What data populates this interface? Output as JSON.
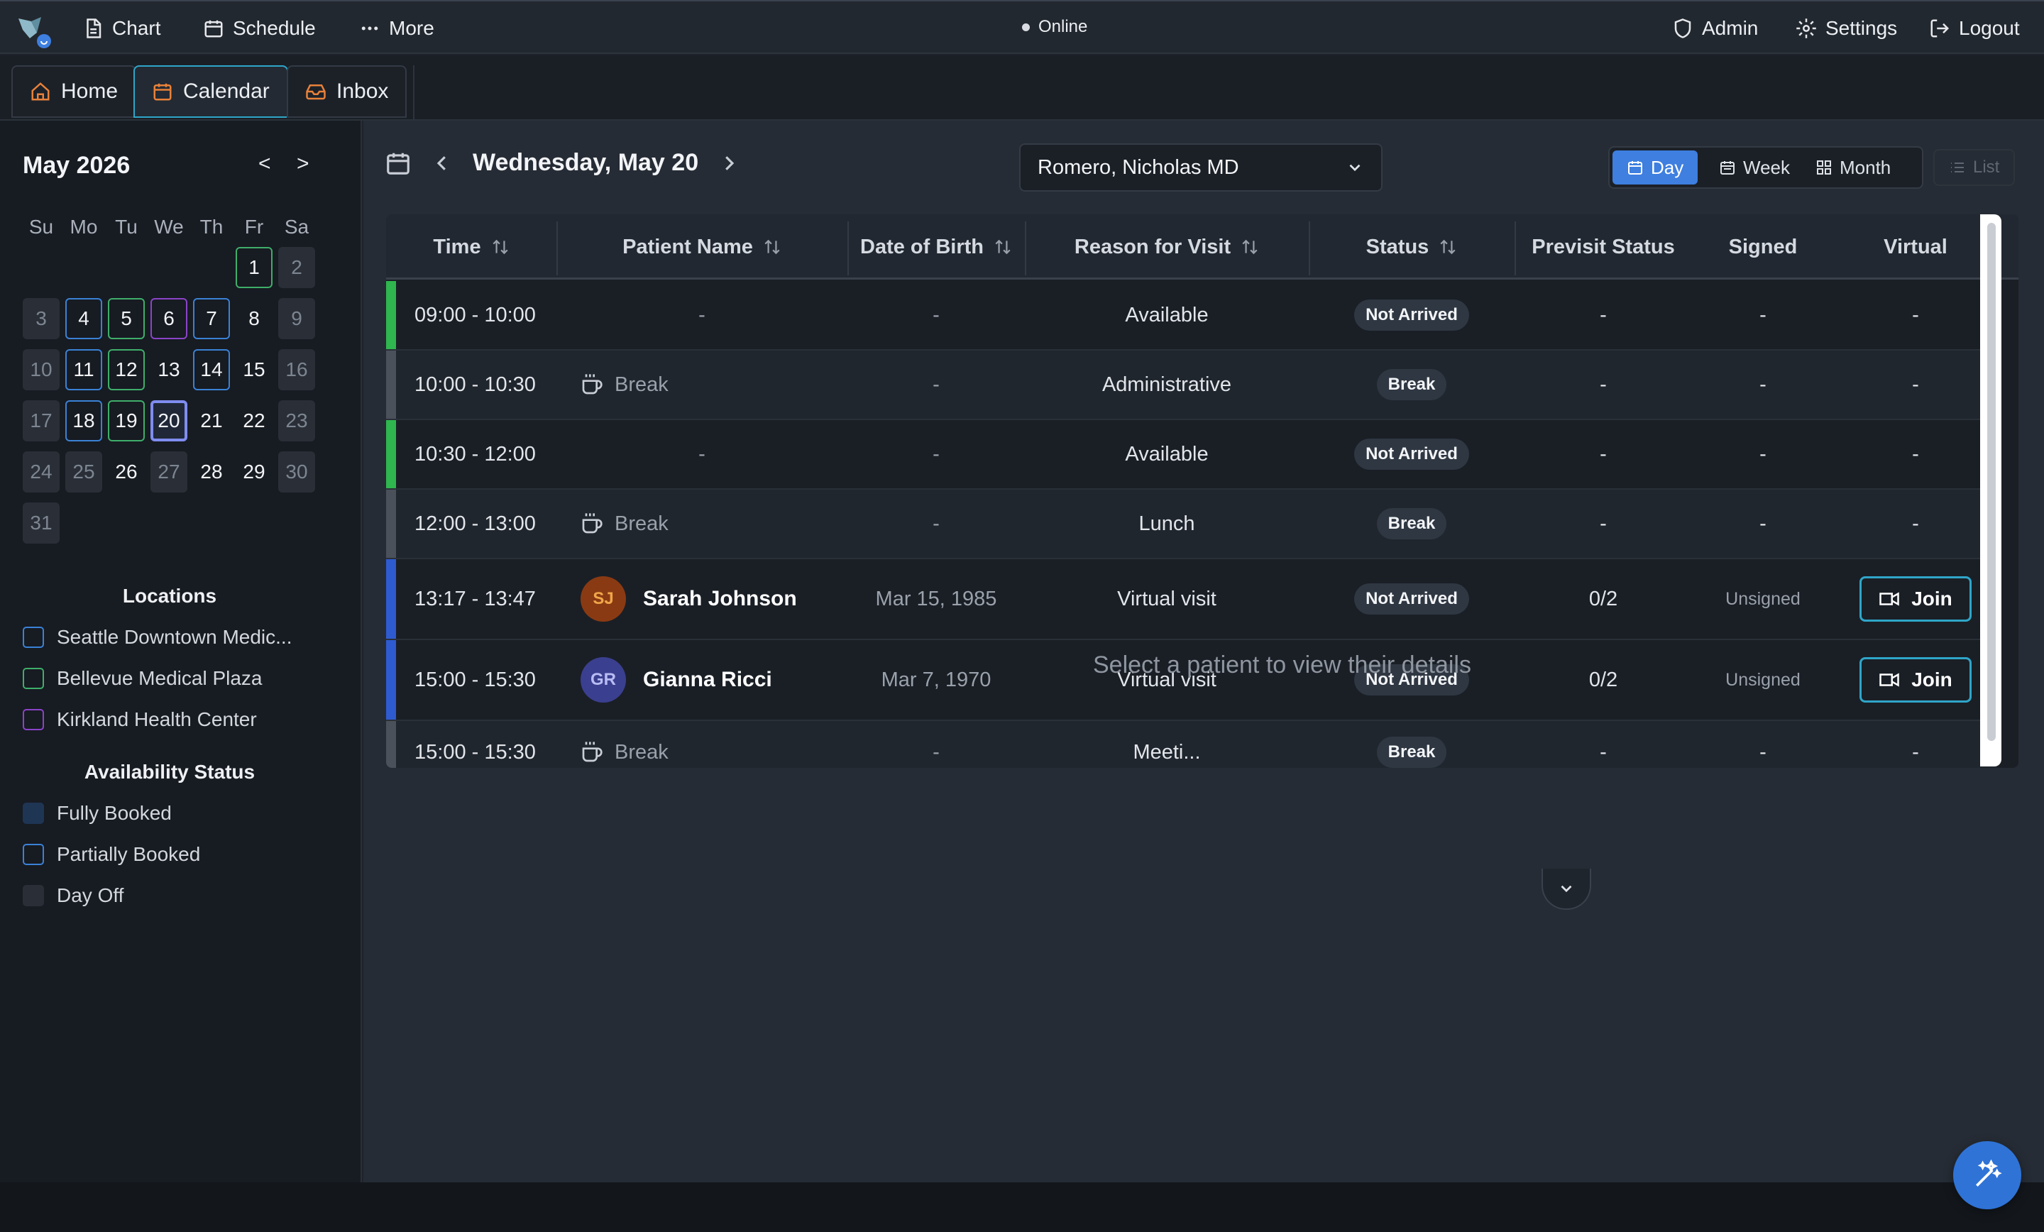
{
  "topbar": {
    "nav": [
      {
        "label": "Chart",
        "icon": "document-icon"
      },
      {
        "label": "Schedule",
        "icon": "calendar-icon"
      },
      {
        "label": "More",
        "icon": "more-dots-icon"
      }
    ],
    "status": "Online",
    "right": [
      {
        "label": "Admin",
        "icon": "shield-icon"
      },
      {
        "label": "Settings",
        "icon": "gear-icon"
      },
      {
        "label": "Logout",
        "icon": "logout-icon"
      }
    ]
  },
  "tabs": [
    {
      "label": "Home",
      "icon": "home-icon",
      "active": false
    },
    {
      "label": "Calendar",
      "icon": "calendar-icon",
      "active": true
    },
    {
      "label": "Inbox",
      "icon": "inbox-icon",
      "active": false
    }
  ],
  "calendar": {
    "month_label": "May 2026",
    "prev": "<",
    "next": ">",
    "weekdays": [
      "Su",
      "Mo",
      "Tu",
      "We",
      "Th",
      "Fr",
      "Sa"
    ],
    "weeks": [
      [
        null,
        null,
        null,
        null,
        null,
        {
          "d": "1",
          "s": "green"
        },
        {
          "d": "2",
          "s": "muted"
        }
      ],
      [
        {
          "d": "3",
          "s": "muted"
        },
        {
          "d": "4",
          "s": "blue"
        },
        {
          "d": "5",
          "s": "green"
        },
        {
          "d": "6",
          "s": "purple"
        },
        {
          "d": "7",
          "s": "blue"
        },
        {
          "d": "8",
          "s": ""
        },
        {
          "d": "9",
          "s": "muted"
        }
      ],
      [
        {
          "d": "10",
          "s": "muted"
        },
        {
          "d": "11",
          "s": "blue"
        },
        {
          "d": "12",
          "s": "green"
        },
        {
          "d": "13",
          "s": ""
        },
        {
          "d": "14",
          "s": "blue"
        },
        {
          "d": "15",
          "s": ""
        },
        {
          "d": "16",
          "s": "muted"
        }
      ],
      [
        {
          "d": "17",
          "s": "muted"
        },
        {
          "d": "18",
          "s": "blue"
        },
        {
          "d": "19",
          "s": "green"
        },
        {
          "d": "20",
          "s": "selected"
        },
        {
          "d": "21",
          "s": ""
        },
        {
          "d": "22",
          "s": ""
        },
        {
          "d": "23",
          "s": "muted"
        }
      ],
      [
        {
          "d": "24",
          "s": "muted"
        },
        {
          "d": "25",
          "s": "muted"
        },
        {
          "d": "26",
          "s": ""
        },
        {
          "d": "27",
          "s": "muted"
        },
        {
          "d": "28",
          "s": ""
        },
        {
          "d": "29",
          "s": ""
        },
        {
          "d": "30",
          "s": "muted"
        }
      ],
      [
        {
          "d": "31",
          "s": "muted"
        },
        null,
        null,
        null,
        null,
        null,
        null
      ]
    ]
  },
  "locations": {
    "heading": "Locations",
    "items": [
      {
        "label": "Seattle Downtown Medic...",
        "color": "#3a82d6"
      },
      {
        "label": "Bellevue Medical Plaza",
        "color": "#3fae6a"
      },
      {
        "label": "Kirkland Health Center",
        "color": "#8a44c9"
      }
    ]
  },
  "availability": {
    "heading": "Availability Status",
    "items": [
      {
        "label": "Fully Booked",
        "color": "#1f3554"
      },
      {
        "label": "Partially Booked",
        "color": "#3a82d6"
      },
      {
        "label": "Day Off",
        "color": "#2a2f37"
      }
    ]
  },
  "header": {
    "date_title": "Wednesday, May 20",
    "provider": "Romero, Nicholas MD",
    "views": [
      "Day",
      "Week",
      "Month"
    ],
    "active_view": "Day",
    "list_label": "List"
  },
  "table": {
    "columns": [
      "Time",
      "Patient Name",
      "Date of Birth",
      "Reason for Visit",
      "Status",
      "Previsit Status",
      "Signed",
      "Virtual"
    ],
    "rows": [
      {
        "time": "09:00 - 10:00",
        "patient": "-",
        "type": "slot",
        "dob": "-",
        "reason": "Available",
        "status": "Not Arrived",
        "previsit": "-",
        "signed": "-",
        "virtual": "-",
        "bar": "#2fb64e"
      },
      {
        "time": "10:00 - 10:30",
        "patient": "Break",
        "type": "break",
        "dob": "-",
        "reason": "Administrative",
        "status": "Break",
        "previsit": "-",
        "signed": "-",
        "virtual": "-",
        "bar": "#4a515b"
      },
      {
        "time": "10:30 - 12:00",
        "patient": "-",
        "type": "slot",
        "dob": "-",
        "reason": "Available",
        "status": "Not Arrived",
        "previsit": "-",
        "signed": "-",
        "virtual": "-",
        "bar": "#2fb64e"
      },
      {
        "time": "12:00 - 13:00",
        "patient": "Break",
        "type": "break",
        "dob": "-",
        "reason": "Lunch",
        "status": "Break",
        "previsit": "-",
        "signed": "-",
        "virtual": "-",
        "bar": "#4a515b"
      },
      {
        "time": "13:17 - 13:47",
        "patient": "Sarah Johnson",
        "initials": "SJ",
        "avatar_bg": "#8a3a12",
        "avatar_fg": "#f0a64a",
        "type": "patient",
        "dob": "Mar 15, 1985",
        "reason": "Virtual visit",
        "status": "Not Arrived",
        "previsit": "0/2",
        "signed": "Unsigned",
        "virtual": "Join",
        "bar": "#2e5bd0"
      },
      {
        "time": "15:00 - 15:30",
        "patient": "Gianna Ricci",
        "initials": "GR",
        "avatar_bg": "#3b3f8f",
        "avatar_fg": "#b8bcf4",
        "type": "patient",
        "dob": "Mar 7, 1970",
        "reason": "Virtual visit",
        "status": "Not Arrived",
        "previsit": "0/2",
        "signed": "Unsigned",
        "virtual": "Join",
        "bar": "#2e5bd0"
      },
      {
        "time": "15:00 - 15:30",
        "patient": "Break",
        "type": "break",
        "dob": "-",
        "reason": "Meeti...",
        "status": "Break",
        "previsit": "-",
        "signed": "-",
        "virtual": "-",
        "bar": "#4a515b"
      }
    ]
  },
  "empty_state": "Select a patient to view their details",
  "fab": {
    "icon": "magic-wand-icon"
  }
}
